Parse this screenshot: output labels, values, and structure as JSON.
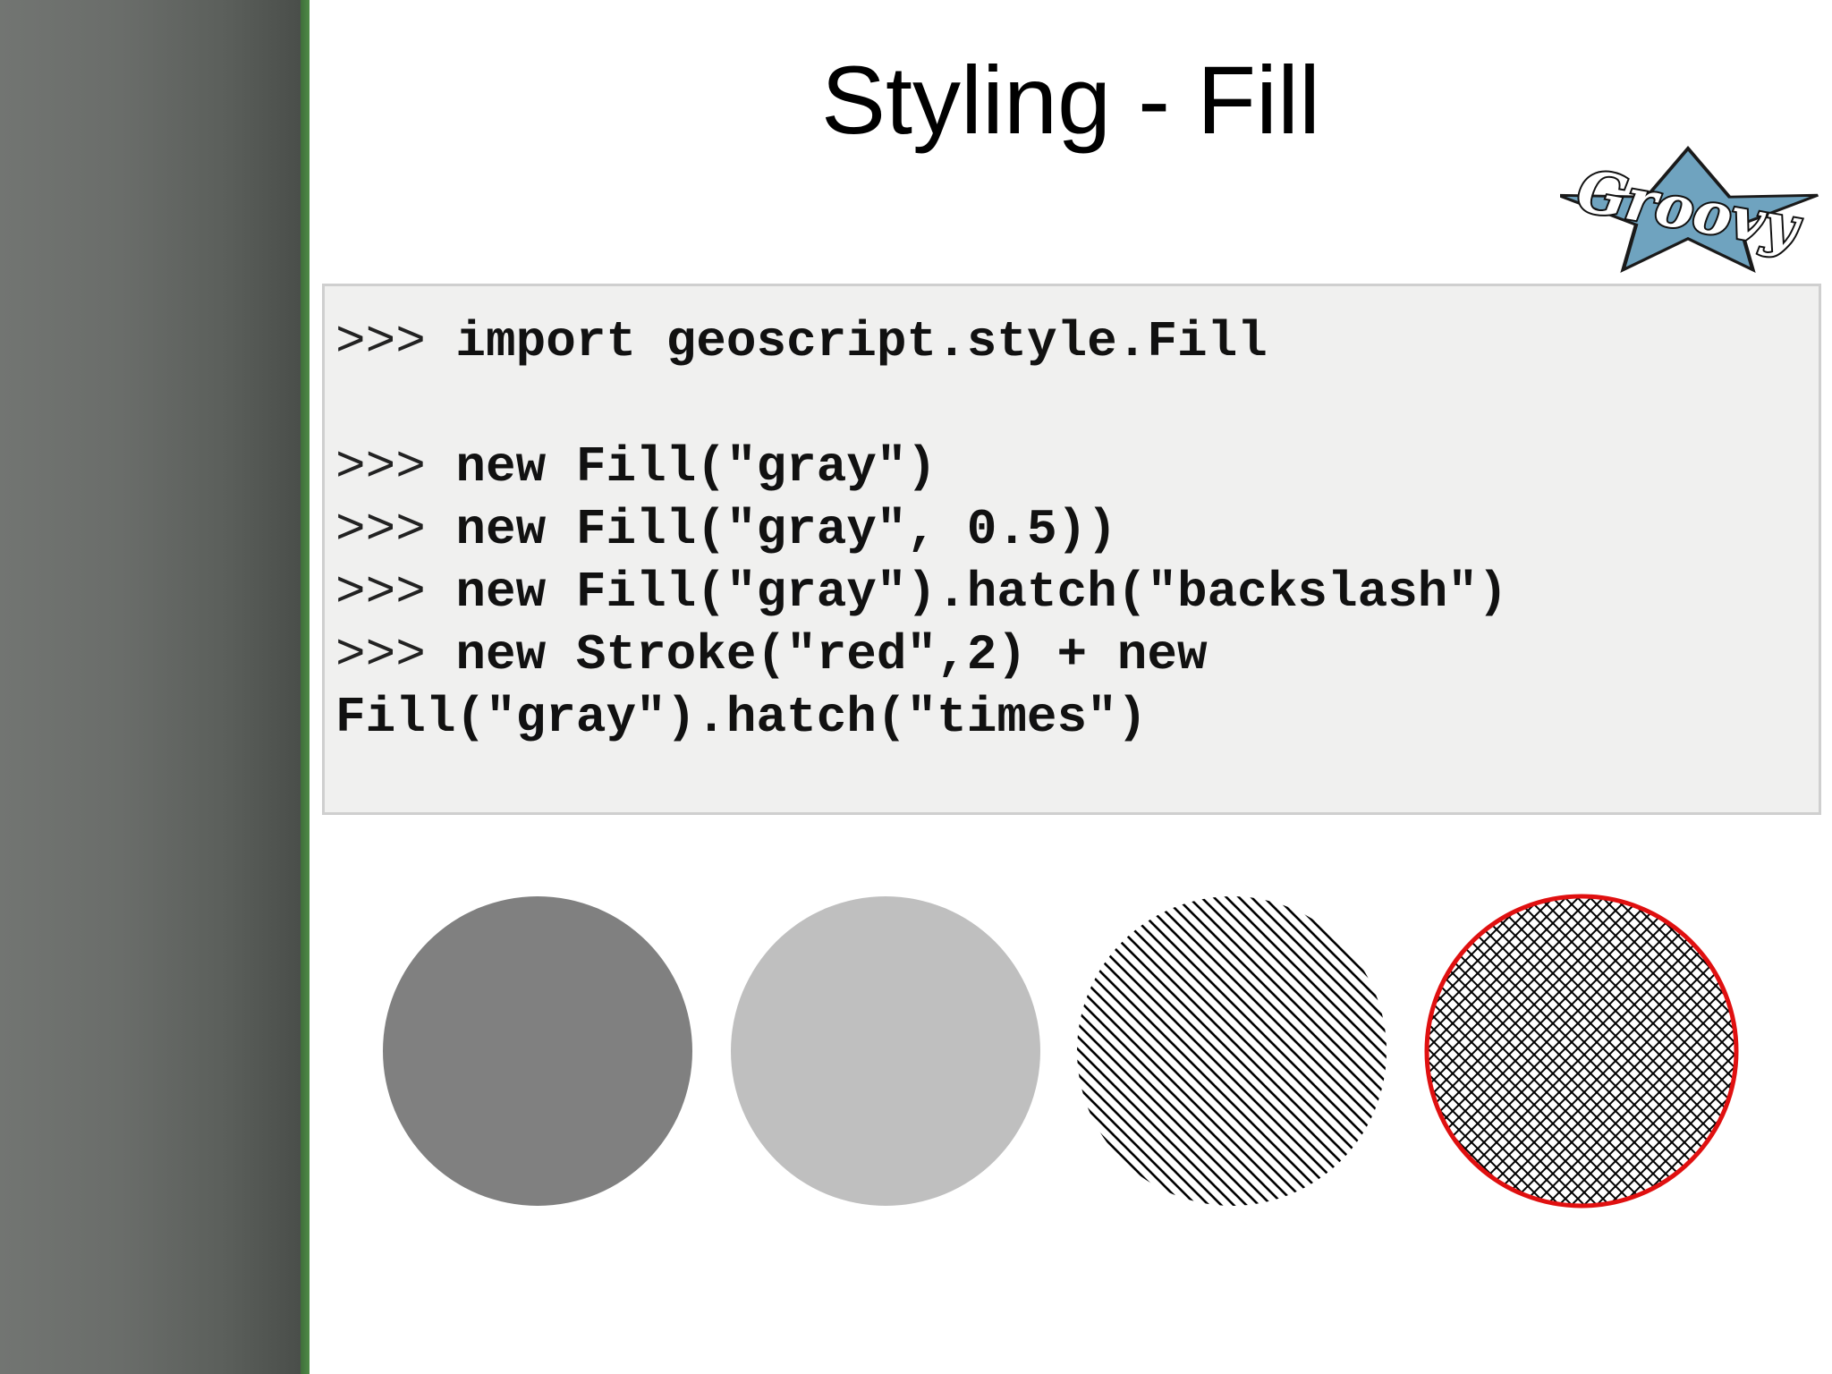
{
  "slide": {
    "title": "Styling - Fill"
  },
  "logo": {
    "text": "Groovy",
    "icon": "groovy-star-logo",
    "star_color": "#6fa3bf"
  },
  "code": {
    "lines": [
      {
        "prompt": ">>>",
        "text": " import geoscript.style.Fill"
      },
      {
        "prompt": "",
        "text": ""
      },
      {
        "prompt": ">>>",
        "text": " new Fill(\"gray\")"
      },
      {
        "prompt": ">>>",
        "text": " new Fill(\"gray\", 0.5))"
      },
      {
        "prompt": ">>>",
        "text": " new Fill(\"gray\").hatch(\"backslash\")"
      },
      {
        "prompt": ">>>",
        "text": " new Stroke(\"red\",2) + new"
      },
      {
        "prompt": "",
        "text": "Fill(\"gray\").hatch(\"times\")"
      }
    ]
  },
  "examples": {
    "colors": {
      "gray": "#808080",
      "gray_half": "#bfbfbf",
      "stroke_red": "#e01010",
      "hatch": "#000000"
    },
    "items": [
      {
        "fill": "gray",
        "opacity": 1,
        "hatch": "none",
        "stroke": "none"
      },
      {
        "fill": "gray",
        "opacity": 0.5,
        "hatch": "none",
        "stroke": "none"
      },
      {
        "fill": "gray",
        "opacity": 1,
        "hatch": "backslash",
        "stroke": "none"
      },
      {
        "fill": "gray",
        "opacity": 1,
        "hatch": "times",
        "stroke": "red"
      }
    ]
  }
}
